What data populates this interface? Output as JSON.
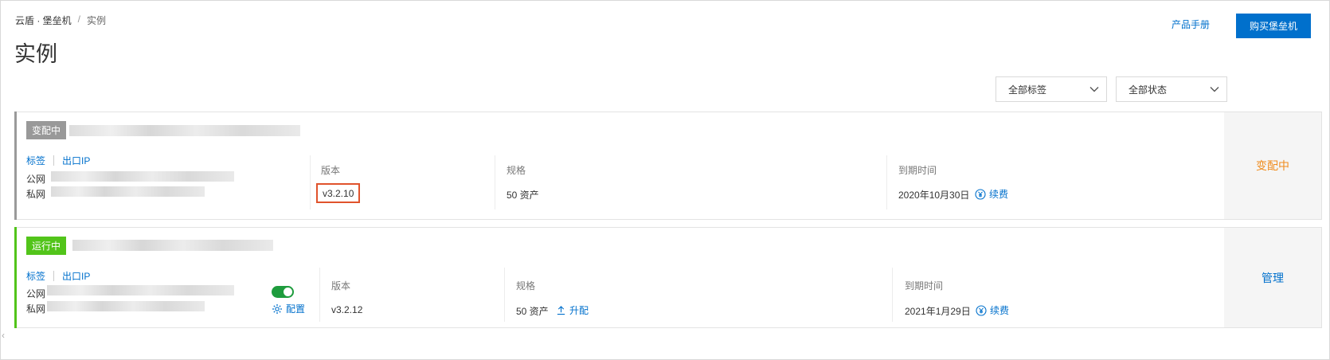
{
  "breadcrumb": {
    "root": "云盾 · 堡垒机",
    "separator": "/",
    "current": "实例"
  },
  "page_title": "实例",
  "header": {
    "manual_label": "产品手册",
    "buy_label": "购买堡垒机"
  },
  "filters": {
    "tag_select": "全部标签",
    "status_select": "全部状态"
  },
  "labels": {
    "tag": "标签",
    "egress_ip": "出口IP",
    "public": "公网",
    "private": "私网",
    "version": "版本",
    "spec": "规格",
    "expire": "到期时间",
    "renew": "续费",
    "config": "配置",
    "upgrade": "升配"
  },
  "instances": [
    {
      "status_badge": "变配中",
      "status_color": "#999999",
      "bar_color": "#9a9a9a",
      "version": "v3.2.10",
      "spec": "50 资产",
      "expire": "2020年10月30日",
      "action": "变配中",
      "action_color": "#f08c1e"
    },
    {
      "status_badge": "运行中",
      "status_color": "#52c41a",
      "bar_color": "#52c41a",
      "version": "v3.2.12",
      "spec": "50 资产",
      "expire": "2021年1月29日",
      "action": "管理",
      "action_color": "#0070cc"
    }
  ],
  "colors": {
    "accent": "#0070cc",
    "highlight_box": "#e0532c"
  }
}
